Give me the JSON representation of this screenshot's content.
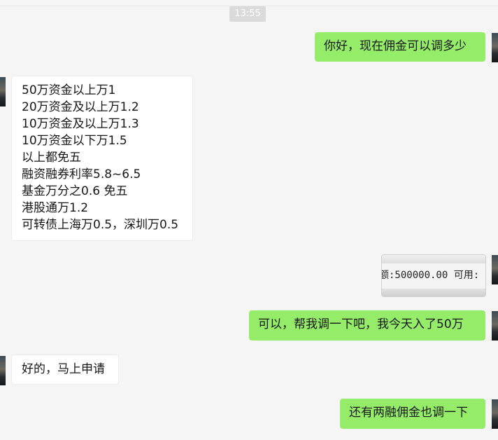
{
  "chat": {
    "timestamp": "13:55",
    "messages": [
      {
        "sender": "me",
        "type": "text",
        "text": "你好，现在佣金可以调多少"
      },
      {
        "sender": "other",
        "type": "text",
        "lines": [
          "50万资金以上万1",
          "20万资金及以上万1.2",
          "10万资金及以上万1.3",
          "10万资金以下万1.5",
          "以上都免五",
          "融资融券利率5.8~6.5",
          "基金万分之0.6 免五",
          "港股通万1.2",
          "可转债上海万0.5，深圳万0.5"
        ]
      },
      {
        "sender": "me",
        "type": "image",
        "image_text": "额:500000.00  可用:"
      },
      {
        "sender": "me",
        "type": "text",
        "text": "可以，帮我调一下吧，我今天入了50万"
      },
      {
        "sender": "other",
        "type": "text",
        "text": "好的，马上申请"
      },
      {
        "sender": "me",
        "type": "text",
        "text": "还有两融佣金也调一下"
      }
    ]
  }
}
